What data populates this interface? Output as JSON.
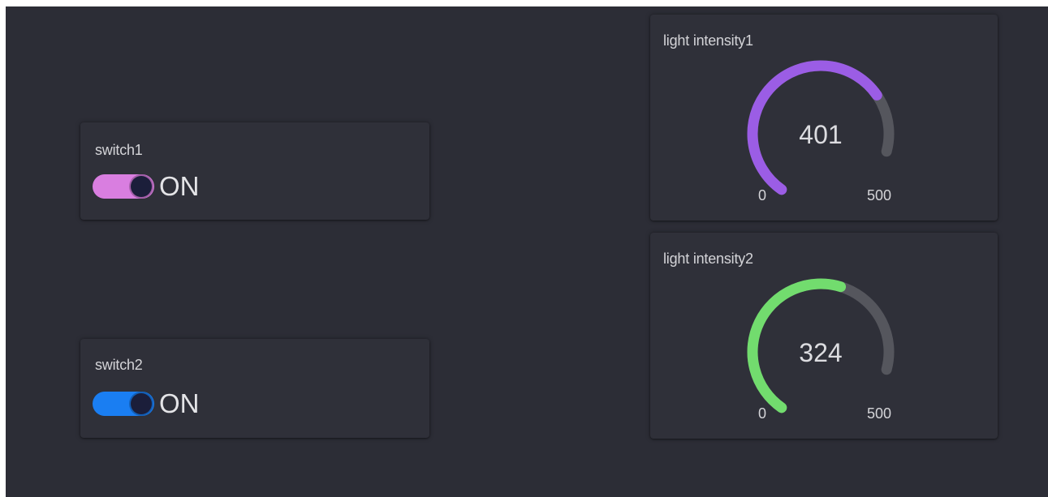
{
  "switches": [
    {
      "title": "switch1",
      "state": "ON",
      "color": "#d97ee0"
    },
    {
      "title": "switch2",
      "state": "ON",
      "color": "#1a7ef2"
    }
  ],
  "gauges": [
    {
      "title": "light intensity1",
      "value": 401,
      "min": 0,
      "max": 500,
      "color": "#9b5de5",
      "track_color": "#55565d"
    },
    {
      "title": "light intensity2",
      "value": 324,
      "min": 0,
      "max": 500,
      "color": "#72dc6e",
      "track_color": "#55565d"
    }
  ]
}
